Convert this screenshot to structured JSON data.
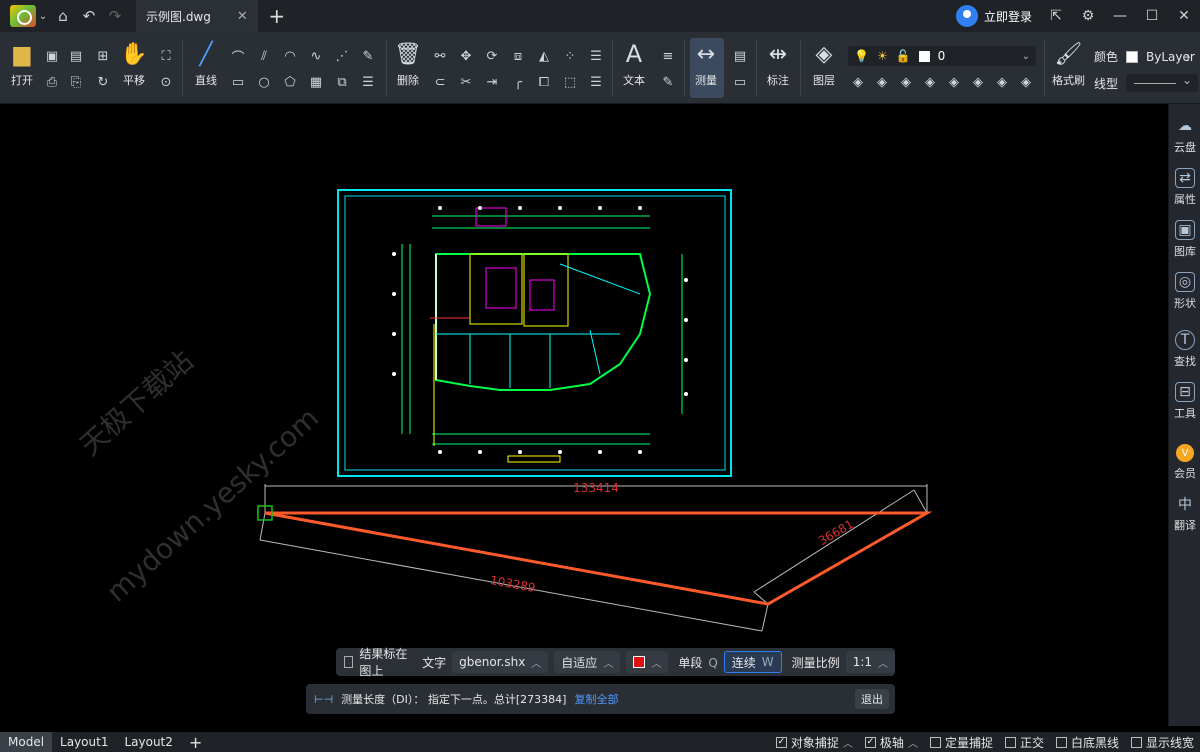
{
  "titlebar": {
    "tab_title": "示例图.dwg",
    "login_label": "立即登录"
  },
  "ribbon": {
    "open": "打开",
    "pan": "平移",
    "line": "直线",
    "delete": "删除",
    "text": "文本",
    "measure": "测量",
    "dimension": "标注",
    "layer": "图层",
    "layer_value": "0",
    "color_label": "颜色",
    "color_value": "ByLayer",
    "format_brush": "格式刷",
    "linetype_label": "线型"
  },
  "sidepanel": [
    {
      "label": "云盘",
      "icon": "cloud-icon"
    },
    {
      "label": "属性",
      "icon": "properties-icon"
    },
    {
      "label": "图库",
      "icon": "gallery-icon"
    },
    {
      "label": "形状",
      "icon": "shapes-icon"
    },
    {
      "label": "查找",
      "icon": "search-icon"
    },
    {
      "label": "工具",
      "icon": "toolbox-icon"
    },
    {
      "label": "会员",
      "icon": "vip-icon"
    },
    {
      "label": "翻译",
      "icon": "translate-icon"
    }
  ],
  "canvas": {
    "dim_top": "133414",
    "dim_left": "103289",
    "dim_right": "36681",
    "watermark1": "天极下载站",
    "watermark2": "mydown.yesky.com"
  },
  "optbar": {
    "mark_on_layer": "结果标在图上",
    "text_label": "文字",
    "font": "gbenor.shx",
    "adaptive": "自适应",
    "single": "单段",
    "single_key": "Q",
    "continuous": "连续",
    "continuous_key": "W",
    "scale_label": "测量比例",
    "scale_value": "1:1"
  },
  "cmdline": {
    "prompt": "测量长度（DI）：  指定下一点。总计[273384]",
    "copy_all": "复制全部",
    "exit": "退出"
  },
  "statusbar": {
    "layouts": [
      "Model",
      "Layout1",
      "Layout2"
    ],
    "toggles": [
      {
        "label": "对象捕捉",
        "checked": true
      },
      {
        "label": "极轴",
        "checked": true
      },
      {
        "label": "定量捕捉",
        "checked": false
      },
      {
        "label": "正交",
        "checked": false
      },
      {
        "label": "白底黑线",
        "checked": false
      },
      {
        "label": "显示线宽",
        "checked": false
      }
    ]
  },
  "colors": {
    "accent": "#2f7ff0",
    "measure_line": "#ff5a2a",
    "drawing_frame": "#00e5ee",
    "dim_text": "#d83030"
  }
}
